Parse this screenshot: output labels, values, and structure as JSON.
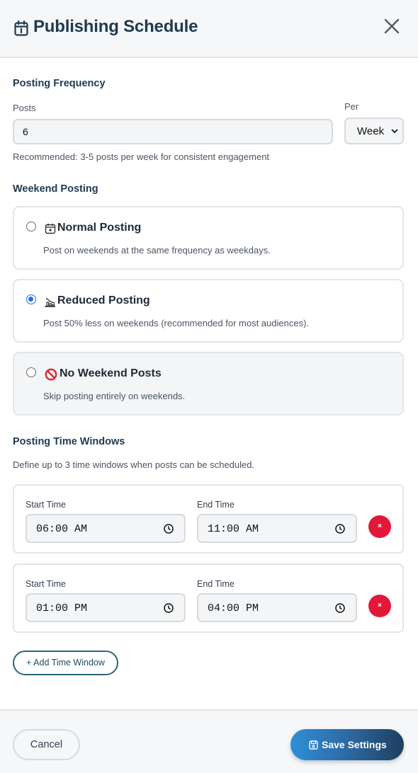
{
  "header": {
    "title": "Publishing Schedule",
    "icon": "calendar-icon",
    "close_icon": "close-icon"
  },
  "frequency": {
    "section_title": "Posting Frequency",
    "posts_label": "Posts",
    "posts_value": "6",
    "per_label": "Per",
    "per_value": "Week",
    "help": "Recommended: 3-5 posts per week for consistent engagement"
  },
  "weekend": {
    "section_title": "Weekend Posting",
    "selected": "reduced",
    "options": [
      {
        "id": "normal",
        "icon": "calendar-icon",
        "title": "Normal Posting",
        "description": "Post on weekends at the same frequency as weekdays."
      },
      {
        "id": "reduced",
        "icon": "chart-decreasing-icon",
        "title": "Reduced Posting",
        "description": "Post 50% less on weekends (recommended for most audiences)."
      },
      {
        "id": "none",
        "icon": "prohibited-icon",
        "title": "No Weekend Posts",
        "description": "Skip posting entirely on weekends."
      }
    ]
  },
  "time_windows": {
    "section_title": "Posting Time Windows",
    "help": "Define up to 3 time windows when posts can be scheduled.",
    "start_label": "Start Time",
    "end_label": "End Time",
    "remove_label": "×",
    "windows": [
      {
        "start": "06:00 AM",
        "end": "11:00 AM"
      },
      {
        "start": "01:00 PM",
        "end": "04:00 PM"
      }
    ],
    "add_label": "+ Add Time Window"
  },
  "footer": {
    "cancel_label": "Cancel",
    "save_label": "Save Settings"
  },
  "colors": {
    "title": "#1e3a52",
    "accent": "#1a73e8",
    "remove": "#e3173a",
    "save_gradient_start": "#2f8fd8",
    "save_gradient_end": "#1f3f5e"
  }
}
